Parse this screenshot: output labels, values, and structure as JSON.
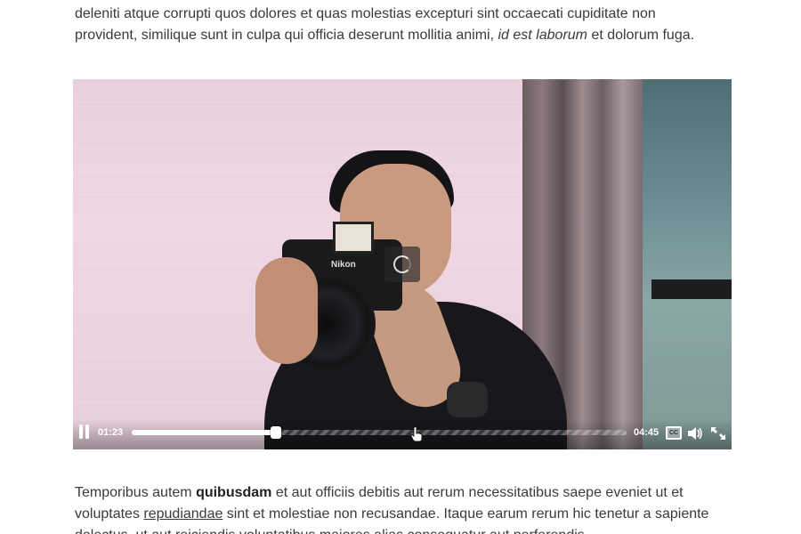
{
  "article": {
    "para_top": {
      "line1": "deleniti atque corrupti quos dolores et quas molestias excepturi sint occaecati cupiditate non",
      "line2_start": "provident, similique sunt in culpa qui officia deserunt mollitia animi, ",
      "line2_italic": "id est laborum",
      "line2_end": " et dolorum fuga."
    },
    "para_bottom": {
      "start": "Temporibus autem ",
      "bold": "quibusdam",
      "mid": " et aut officiis debitis aut rerum necessitatibus saepe eveniet ut et voluptates ",
      "underline": "repudiandae",
      "end": " sint et molestiae non recusandae. Itaque earum rerum hic tenetur a sapiente delectus, ut aut reiciendis voluptatibus maiores alias consequatur aut perferendis"
    }
  },
  "video": {
    "brand_text": "Nikon",
    "state": "playing-buffering",
    "time_current": "01:23",
    "time_total": "04:45",
    "progress_fraction": 0.291,
    "icons": {
      "pause": "pause-icon",
      "captions": "cc-icon",
      "volume": "volume-icon",
      "fullscreen": "fullscreen-icon",
      "loading": "loading-spinner-icon",
      "cursor": "hand-cursor-icon"
    },
    "cc_label": "CC"
  },
  "colors": {
    "text": "#3a3a3a",
    "control_fg": "#ffffff"
  }
}
